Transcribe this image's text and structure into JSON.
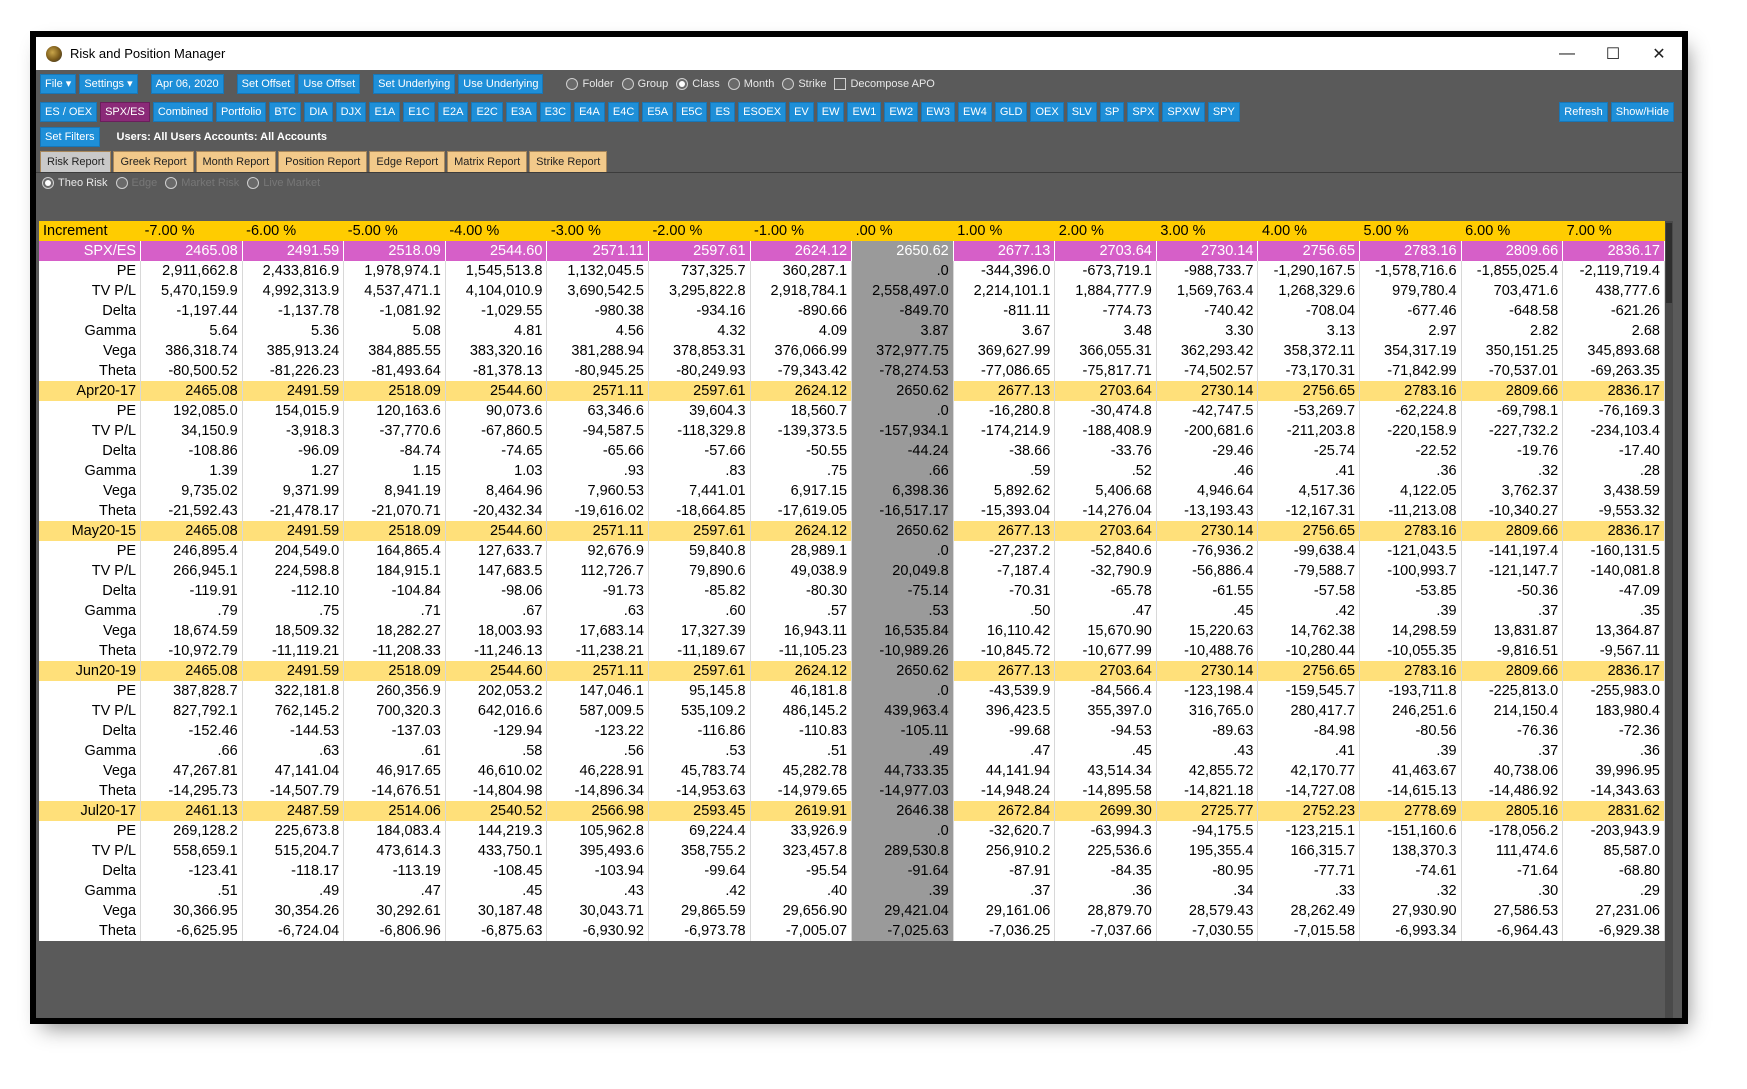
{
  "window": {
    "title": "Risk and Position Manager",
    "min": "—",
    "max": "☐",
    "close": "✕"
  },
  "toolbar": {
    "file": "File ▾",
    "settings": "Settings ▾",
    "date": "Apr 06, 2020",
    "set_offset": "Set Offset",
    "use_offset": "Use Offset",
    "set_underlying": "Set Underlying",
    "use_underlying": "Use Underlying",
    "radios": [
      {
        "label": "Folder",
        "checked": false
      },
      {
        "label": "Group",
        "checked": false
      },
      {
        "label": "Class",
        "checked": true
      },
      {
        "label": "Month",
        "checked": false
      },
      {
        "label": "Strike",
        "checked": false
      }
    ],
    "decompose": "Decompose APO"
  },
  "symbols": [
    "ES / OEX",
    "SPX/ES",
    "Combined",
    "Portfolio",
    "BTC",
    "DIA",
    "DJX",
    "E1A",
    "E1C",
    "E2A",
    "E2C",
    "E3A",
    "E3C",
    "E4A",
    "E4C",
    "E5A",
    "E5C",
    "ES",
    "ESOEX",
    "EV",
    "EW",
    "EW1",
    "EW2",
    "EW3",
    "EW4",
    "GLD",
    "OEX",
    "SLV",
    "SP",
    "SPX",
    "SPXW",
    "SPY"
  ],
  "active_symbol": "SPX/ES",
  "refresh": "Refresh",
  "show_hide": "Show/Hide",
  "filters": {
    "button": "Set Filters",
    "text": "Users: All Users  Accounts: All Accounts"
  },
  "tabs": [
    "Risk Report",
    "Greek Report",
    "Month Report",
    "Position Report",
    "Edge Report",
    "Matrix Report",
    "Strike Report"
  ],
  "active_tab": "Risk Report",
  "risk_modes": [
    {
      "label": "Theo Risk",
      "checked": true,
      "enabled": true
    },
    {
      "label": "Edge",
      "checked": false,
      "enabled": false
    },
    {
      "label": "Market Risk",
      "checked": false,
      "enabled": false
    },
    {
      "label": "Live Market",
      "checked": false,
      "enabled": false
    }
  ],
  "grid": {
    "increment_label": "Increment",
    "increments": [
      "-7.00 %",
      "-6.00 %",
      "-5.00 %",
      "-4.00 %",
      "-3.00 %",
      "-2.00 %",
      "-1.00 %",
      ".00 %",
      "1.00 %",
      "2.00 %",
      "3.00 %",
      "4.00 %",
      "5.00 %",
      "6.00 %",
      "7.00 %"
    ],
    "rows": [
      {
        "type": "hdr",
        "label": "SPX/ES",
        "values": [
          "2465.08",
          "2491.59",
          "2518.09",
          "2544.60",
          "2571.11",
          "2597.61",
          "2624.12",
          "2650.62",
          "2677.13",
          "2703.64",
          "2730.14",
          "2756.65",
          "2783.16",
          "2809.66",
          "2836.17"
        ]
      },
      {
        "type": "dat",
        "label": "PE",
        "values": [
          "2,911,662.8",
          "2,433,816.9",
          "1,978,974.1",
          "1,545,513.8",
          "1,132,045.5",
          "737,325.7",
          "360,287.1",
          ".0",
          "-344,396.0",
          "-673,719.1",
          "-988,733.7",
          "-1,290,167.5",
          "-1,578,716.6",
          "-1,855,025.4",
          "-2,119,719.4"
        ]
      },
      {
        "type": "dat",
        "label": "TV P/L",
        "values": [
          "5,470,159.9",
          "4,992,313.9",
          "4,537,471.1",
          "4,104,010.9",
          "3,690,542.5",
          "3,295,822.8",
          "2,918,784.1",
          "2,558,497.0",
          "2,214,101.1",
          "1,884,777.9",
          "1,569,763.4",
          "1,268,329.6",
          "979,780.4",
          "703,471.6",
          "438,777.6"
        ]
      },
      {
        "type": "dat",
        "label": "Delta",
        "values": [
          "-1,197.44",
          "-1,137.78",
          "-1,081.92",
          "-1,029.55",
          "-980.38",
          "-934.16",
          "-890.66",
          "-849.70",
          "-811.11",
          "-774.73",
          "-740.42",
          "-708.04",
          "-677.46",
          "-648.58",
          "-621.26"
        ]
      },
      {
        "type": "dat",
        "label": "Gamma",
        "values": [
          "5.64",
          "5.36",
          "5.08",
          "4.81",
          "4.56",
          "4.32",
          "4.09",
          "3.87",
          "3.67",
          "3.48",
          "3.30",
          "3.13",
          "2.97",
          "2.82",
          "2.68"
        ]
      },
      {
        "type": "dat",
        "label": "Vega",
        "values": [
          "386,318.74",
          "385,913.24",
          "384,885.55",
          "383,320.16",
          "381,288.94",
          "378,853.31",
          "376,066.99",
          "372,977.75",
          "369,627.99",
          "366,055.31",
          "362,293.42",
          "358,372.11",
          "354,317.19",
          "350,151.25",
          "345,893.68"
        ]
      },
      {
        "type": "dat",
        "label": "Theta",
        "values": [
          "-80,500.52",
          "-81,226.23",
          "-81,493.64",
          "-81,378.13",
          "-80,945.25",
          "-80,249.93",
          "-79,343.42",
          "-78,274.53",
          "-77,086.65",
          "-75,817.71",
          "-74,502.57",
          "-73,170.31",
          "-71,842.99",
          "-70,537.01",
          "-69,263.35"
        ]
      },
      {
        "type": "grp",
        "label": "Apr20-17",
        "values": [
          "2465.08",
          "2491.59",
          "2518.09",
          "2544.60",
          "2571.11",
          "2597.61",
          "2624.12",
          "2650.62",
          "2677.13",
          "2703.64",
          "2730.14",
          "2756.65",
          "2783.16",
          "2809.66",
          "2836.17"
        ]
      },
      {
        "type": "dat",
        "label": "PE",
        "values": [
          "192,085.0",
          "154,015.9",
          "120,163.6",
          "90,073.6",
          "63,346.6",
          "39,604.3",
          "18,560.7",
          ".0",
          "-16,280.8",
          "-30,474.8",
          "-42,747.5",
          "-53,269.7",
          "-62,224.8",
          "-69,798.1",
          "-76,169.3"
        ]
      },
      {
        "type": "dat",
        "label": "TV P/L",
        "values": [
          "34,150.9",
          "-3,918.3",
          "-37,770.6",
          "-67,860.5",
          "-94,587.5",
          "-118,329.8",
          "-139,373.5",
          "-157,934.1",
          "-174,214.9",
          "-188,408.9",
          "-200,681.6",
          "-211,203.8",
          "-220,158.9",
          "-227,732.2",
          "-234,103.4"
        ]
      },
      {
        "type": "dat",
        "label": "Delta",
        "values": [
          "-108.86",
          "-96.09",
          "-84.74",
          "-74.65",
          "-65.66",
          "-57.66",
          "-50.55",
          "-44.24",
          "-38.66",
          "-33.76",
          "-29.46",
          "-25.74",
          "-22.52",
          "-19.76",
          "-17.40"
        ]
      },
      {
        "type": "dat",
        "label": "Gamma",
        "values": [
          "1.39",
          "1.27",
          "1.15",
          "1.03",
          ".93",
          ".83",
          ".75",
          ".66",
          ".59",
          ".52",
          ".46",
          ".41",
          ".36",
          ".32",
          ".28"
        ]
      },
      {
        "type": "dat",
        "label": "Vega",
        "values": [
          "9,735.02",
          "9,371.99",
          "8,941.19",
          "8,464.96",
          "7,960.53",
          "7,441.01",
          "6,917.15",
          "6,398.36",
          "5,892.62",
          "5,406.68",
          "4,946.64",
          "4,517.36",
          "4,122.05",
          "3,762.37",
          "3,438.59"
        ]
      },
      {
        "type": "dat",
        "label": "Theta",
        "values": [
          "-21,592.43",
          "-21,478.17",
          "-21,070.71",
          "-20,432.34",
          "-19,616.02",
          "-18,664.85",
          "-17,619.05",
          "-16,517.17",
          "-15,393.04",
          "-14,276.04",
          "-13,193.43",
          "-12,167.31",
          "-11,213.08",
          "-10,340.27",
          "-9,553.32"
        ]
      },
      {
        "type": "grp",
        "label": "May20-15",
        "values": [
          "2465.08",
          "2491.59",
          "2518.09",
          "2544.60",
          "2571.11",
          "2597.61",
          "2624.12",
          "2650.62",
          "2677.13",
          "2703.64",
          "2730.14",
          "2756.65",
          "2783.16",
          "2809.66",
          "2836.17"
        ]
      },
      {
        "type": "dat",
        "label": "PE",
        "values": [
          "246,895.4",
          "204,549.0",
          "164,865.4",
          "127,633.7",
          "92,676.9",
          "59,840.8",
          "28,989.1",
          ".0",
          "-27,237.2",
          "-52,840.6",
          "-76,936.2",
          "-99,638.4",
          "-121,043.5",
          "-141,197.4",
          "-160,131.5"
        ]
      },
      {
        "type": "dat",
        "label": "TV P/L",
        "values": [
          "266,945.1",
          "224,598.8",
          "184,915.1",
          "147,683.5",
          "112,726.7",
          "79,890.6",
          "49,038.9",
          "20,049.8",
          "-7,187.4",
          "-32,790.9",
          "-56,886.4",
          "-79,588.7",
          "-100,993.7",
          "-121,147.7",
          "-140,081.8"
        ]
      },
      {
        "type": "dat",
        "label": "Delta",
        "values": [
          "-119.91",
          "-112.10",
          "-104.84",
          "-98.06",
          "-91.73",
          "-85.82",
          "-80.30",
          "-75.14",
          "-70.31",
          "-65.78",
          "-61.55",
          "-57.58",
          "-53.85",
          "-50.36",
          "-47.09"
        ]
      },
      {
        "type": "dat",
        "label": "Gamma",
        "values": [
          ".79",
          ".75",
          ".71",
          ".67",
          ".63",
          ".60",
          ".57",
          ".53",
          ".50",
          ".47",
          ".45",
          ".42",
          ".39",
          ".37",
          ".35"
        ]
      },
      {
        "type": "dat",
        "label": "Vega",
        "values": [
          "18,674.59",
          "18,509.32",
          "18,282.27",
          "18,003.93",
          "17,683.14",
          "17,327.39",
          "16,943.11",
          "16,535.84",
          "16,110.42",
          "15,670.90",
          "15,220.63",
          "14,762.38",
          "14,298.59",
          "13,831.87",
          "13,364.87"
        ]
      },
      {
        "type": "dat",
        "label": "Theta",
        "values": [
          "-10,972.79",
          "-11,119.21",
          "-11,208.33",
          "-11,246.13",
          "-11,238.21",
          "-11,189.67",
          "-11,105.23",
          "-10,989.26",
          "-10,845.72",
          "-10,677.99",
          "-10,488.76",
          "-10,280.44",
          "-10,055.35",
          "-9,816.51",
          "-9,567.11"
        ]
      },
      {
        "type": "grp",
        "label": "Jun20-19",
        "values": [
          "2465.08",
          "2491.59",
          "2518.09",
          "2544.60",
          "2571.11",
          "2597.61",
          "2624.12",
          "2650.62",
          "2677.13",
          "2703.64",
          "2730.14",
          "2756.65",
          "2783.16",
          "2809.66",
          "2836.17"
        ]
      },
      {
        "type": "dat",
        "label": "PE",
        "values": [
          "387,828.7",
          "322,181.8",
          "260,356.9",
          "202,053.2",
          "147,046.1",
          "95,145.8",
          "46,181.8",
          ".0",
          "-43,539.9",
          "-84,566.4",
          "-123,198.4",
          "-159,545.7",
          "-193,711.8",
          "-225,813.0",
          "-255,983.0"
        ]
      },
      {
        "type": "dat",
        "label": "TV P/L",
        "values": [
          "827,792.1",
          "762,145.2",
          "700,320.3",
          "642,016.6",
          "587,009.5",
          "535,109.2",
          "486,145.2",
          "439,963.4",
          "396,423.5",
          "355,397.0",
          "316,765.0",
          "280,417.7",
          "246,251.6",
          "214,150.4",
          "183,980.4"
        ]
      },
      {
        "type": "dat",
        "label": "Delta",
        "values": [
          "-152.46",
          "-144.53",
          "-137.03",
          "-129.94",
          "-123.22",
          "-116.86",
          "-110.83",
          "-105.11",
          "-99.68",
          "-94.53",
          "-89.63",
          "-84.98",
          "-80.56",
          "-76.36",
          "-72.36"
        ]
      },
      {
        "type": "dat",
        "label": "Gamma",
        "values": [
          ".66",
          ".63",
          ".61",
          ".58",
          ".56",
          ".53",
          ".51",
          ".49",
          ".47",
          ".45",
          ".43",
          ".41",
          ".39",
          ".37",
          ".36"
        ]
      },
      {
        "type": "dat",
        "label": "Vega",
        "values": [
          "47,267.81",
          "47,141.04",
          "46,917.65",
          "46,610.02",
          "46,228.91",
          "45,783.74",
          "45,282.78",
          "44,733.35",
          "44,141.94",
          "43,514.34",
          "42,855.72",
          "42,170.77",
          "41,463.67",
          "40,738.06",
          "39,996.95"
        ]
      },
      {
        "type": "dat",
        "label": "Theta",
        "values": [
          "-14,295.73",
          "-14,507.79",
          "-14,676.51",
          "-14,804.98",
          "-14,896.34",
          "-14,953.63",
          "-14,979.65",
          "-14,977.03",
          "-14,948.24",
          "-14,895.58",
          "-14,821.18",
          "-14,727.08",
          "-14,615.13",
          "-14,486.92",
          "-14,343.63"
        ]
      },
      {
        "type": "grp",
        "label": "Jul20-17",
        "values": [
          "2461.13",
          "2487.59",
          "2514.06",
          "2540.52",
          "2566.98",
          "2593.45",
          "2619.91",
          "2646.38",
          "2672.84",
          "2699.30",
          "2725.77",
          "2752.23",
          "2778.69",
          "2805.16",
          "2831.62"
        ]
      },
      {
        "type": "dat",
        "label": "PE",
        "values": [
          "269,128.2",
          "225,673.8",
          "184,083.4",
          "144,219.3",
          "105,962.8",
          "69,224.4",
          "33,926.9",
          ".0",
          "-32,620.7",
          "-63,994.3",
          "-94,175.5",
          "-123,215.1",
          "-151,160.6",
          "-178,056.2",
          "-203,943.9"
        ]
      },
      {
        "type": "dat",
        "label": "TV P/L",
        "values": [
          "558,659.1",
          "515,204.7",
          "473,614.3",
          "433,750.1",
          "395,493.6",
          "358,755.2",
          "323,457.8",
          "289,530.8",
          "256,910.2",
          "225,536.6",
          "195,355.4",
          "166,315.7",
          "138,370.3",
          "111,474.6",
          "85,587.0"
        ]
      },
      {
        "type": "dat",
        "label": "Delta",
        "values": [
          "-123.41",
          "-118.17",
          "-113.19",
          "-108.45",
          "-103.94",
          "-99.64",
          "-95.54",
          "-91.64",
          "-87.91",
          "-84.35",
          "-80.95",
          "-77.71",
          "-74.61",
          "-71.64",
          "-68.80"
        ]
      },
      {
        "type": "dat",
        "label": "Gamma",
        "values": [
          ".51",
          ".49",
          ".47",
          ".45",
          ".43",
          ".42",
          ".40",
          ".39",
          ".37",
          ".36",
          ".34",
          ".33",
          ".32",
          ".30",
          ".29"
        ]
      },
      {
        "type": "dat",
        "label": "Vega",
        "values": [
          "30,366.95",
          "30,354.26",
          "30,292.61",
          "30,187.48",
          "30,043.71",
          "29,865.59",
          "29,656.90",
          "29,421.04",
          "29,161.06",
          "28,879.70",
          "28,579.43",
          "28,262.49",
          "27,930.90",
          "27,586.53",
          "27,231.06"
        ]
      },
      {
        "type": "dat",
        "label": "Theta",
        "values": [
          "-6,625.95",
          "-6,724.04",
          "-6,806.96",
          "-6,875.63",
          "-6,930.92",
          "-6,973.78",
          "-7,005.07",
          "-7,025.63",
          "-7,036.25",
          "-7,037.66",
          "-7,030.55",
          "-7,015.58",
          "-6,993.34",
          "-6,964.43",
          "-6,929.38"
        ]
      }
    ]
  },
  "colors": {
    "increment_row": "#ffcc00",
    "underlying_row": "#d65fc8",
    "expiry_row": "#ffe07a",
    "zero_column": "#9a9a9a",
    "button": "#1e8fd8",
    "active_button": "#8b2a78",
    "tab": "#f2c98a"
  }
}
